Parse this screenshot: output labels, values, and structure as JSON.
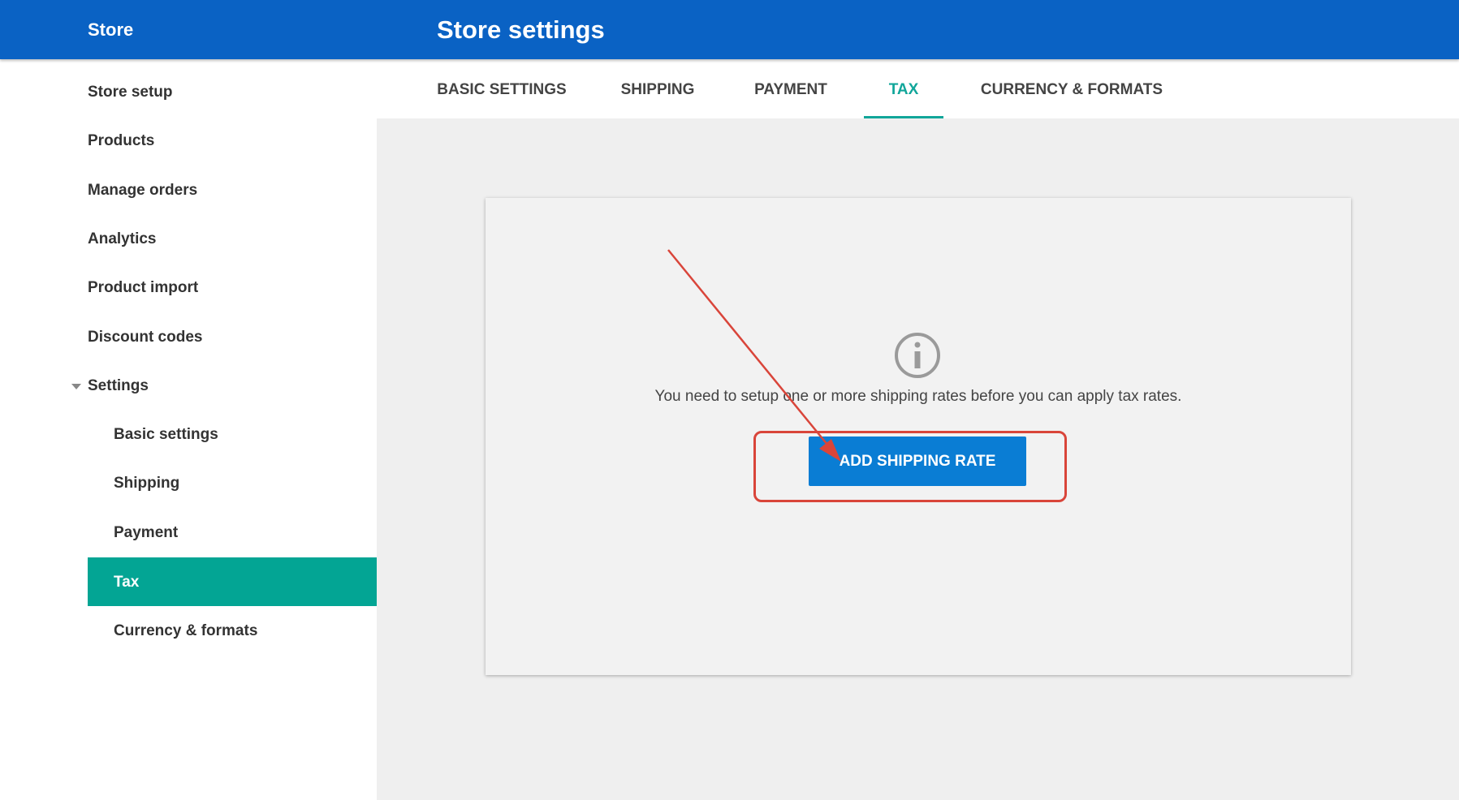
{
  "header": {
    "store_title": "Store",
    "page_title": "Store settings"
  },
  "sidebar": {
    "items": [
      {
        "label": "Store setup"
      },
      {
        "label": "Products"
      },
      {
        "label": "Manage orders"
      },
      {
        "label": "Analytics"
      },
      {
        "label": "Product import"
      },
      {
        "label": "Discount codes"
      },
      {
        "label": "Settings"
      },
      {
        "label": "Basic settings"
      },
      {
        "label": "Shipping"
      },
      {
        "label": "Payment"
      },
      {
        "label": "Tax"
      },
      {
        "label": "Currency & formats"
      }
    ],
    "active_item": "Tax"
  },
  "tabs": [
    {
      "label": "BASIC SETTINGS"
    },
    {
      "label": "SHIPPING"
    },
    {
      "label": "PAYMENT"
    },
    {
      "label": "TAX"
    },
    {
      "label": "CURRENCY & FORMATS"
    }
  ],
  "active_tab": "TAX",
  "main": {
    "message": "You need to setup one or more shipping rates before you can apply tax rates.",
    "add_button_label": "ADD SHIPPING RATE"
  },
  "colors": {
    "header_bg": "#0a62c4",
    "active_nav_bg": "#03a594",
    "active_tab": "#11a69a",
    "button_bg": "#0a7dd4",
    "annotation_red": "#d9453a"
  },
  "icons": {
    "info": "info-circle-icon",
    "settings_caret": "caret-down-icon",
    "annotation_arrow": "arrow-annotation"
  }
}
